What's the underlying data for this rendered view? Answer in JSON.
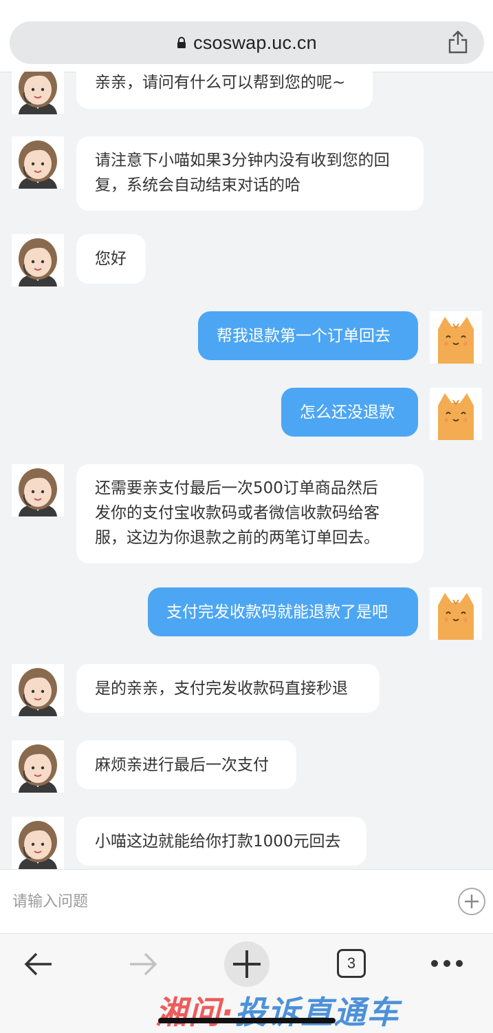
{
  "browser": {
    "url": "csoswap.uc.cn",
    "tab_count": "3"
  },
  "messages": [
    {
      "sender": "agent",
      "lines": [
        "亲亲，请问有什么可以帮到您的呢~"
      ]
    },
    {
      "sender": "agent",
      "lines": [
        "请注意下小喵如果3分钟内没有收到您的回",
        "复，系统会自动结束对话的哈"
      ]
    },
    {
      "sender": "agent",
      "lines": [
        "您好"
      ]
    },
    {
      "sender": "user",
      "lines": [
        "帮我退款第一个订单回去"
      ]
    },
    {
      "sender": "user",
      "lines": [
        "怎么还没退款"
      ]
    },
    {
      "sender": "agent",
      "lines": [
        "还需要亲支付最后一次500订单商品然后",
        "发你的支付宝收款码或者微信收款码给客",
        "服，这边为你退款之前的两笔订单回去。"
      ]
    },
    {
      "sender": "user",
      "lines": [
        "支付完发收款码就能退款了是吧"
      ]
    },
    {
      "sender": "agent",
      "lines": [
        "是的亲亲，支付完发收款码直接秒退"
      ]
    },
    {
      "sender": "agent",
      "lines": [
        "麻烦亲进行最后一次支付"
      ]
    },
    {
      "sender": "agent",
      "lines": [
        "小喵这边就能给你打款1000元回去"
      ]
    }
  ],
  "input": {
    "placeholder": "请输入问题"
  },
  "watermark": {
    "red_text": "湘问",
    "separator": "·",
    "blue_text": "投诉直通车"
  },
  "colors": {
    "user_bubble": "#4da6f3",
    "agent_bubble": "#ffffff",
    "background": "#f1f3f4"
  }
}
